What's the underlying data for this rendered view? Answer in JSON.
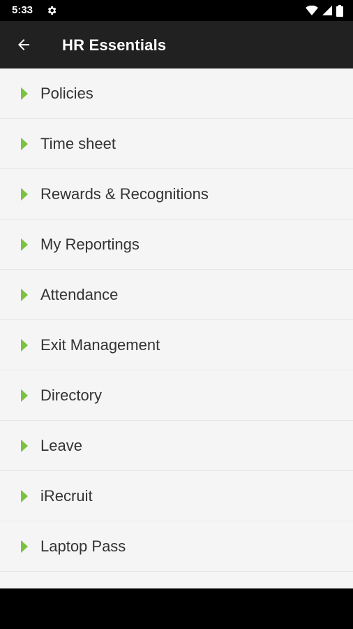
{
  "status_bar": {
    "time": "5:33",
    "icons": [
      "gear-icon",
      "wifi-icon",
      "signal-icon",
      "battery-icon"
    ]
  },
  "app_bar": {
    "title": "HR Essentials",
    "back_icon": "arrow-left-icon"
  },
  "menu": {
    "items": [
      {
        "label": "Policies"
      },
      {
        "label": "Time sheet"
      },
      {
        "label": "Rewards & Recognitions"
      },
      {
        "label": "My Reportings"
      },
      {
        "label": "Attendance"
      },
      {
        "label": "Exit Management"
      },
      {
        "label": "Directory"
      },
      {
        "label": "Leave"
      },
      {
        "label": "iRecruit"
      },
      {
        "label": "Laptop Pass"
      }
    ],
    "arrow_color": "#7cc242"
  },
  "colors": {
    "app_bar": "#212121",
    "background": "#f5f5f5",
    "text": "#333333"
  }
}
